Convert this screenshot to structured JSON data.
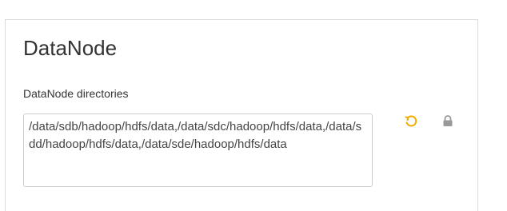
{
  "section": {
    "title": "DataNode"
  },
  "field": {
    "label": "DataNode directories",
    "value": "/data/sdb/hadoop/hdfs/data,/data/sdc/hadoop/hdfs/data,/data/sdd/hadoop/hdfs/data,/data/sde/hadoop/hdfs/data"
  },
  "icons": {
    "undo": "undo-icon",
    "lock": "lock-icon"
  },
  "colors": {
    "undo_accent": "#f0ad00",
    "lock_gray": "#9a9a9a",
    "text": "#333333",
    "border": "#cccccc"
  }
}
